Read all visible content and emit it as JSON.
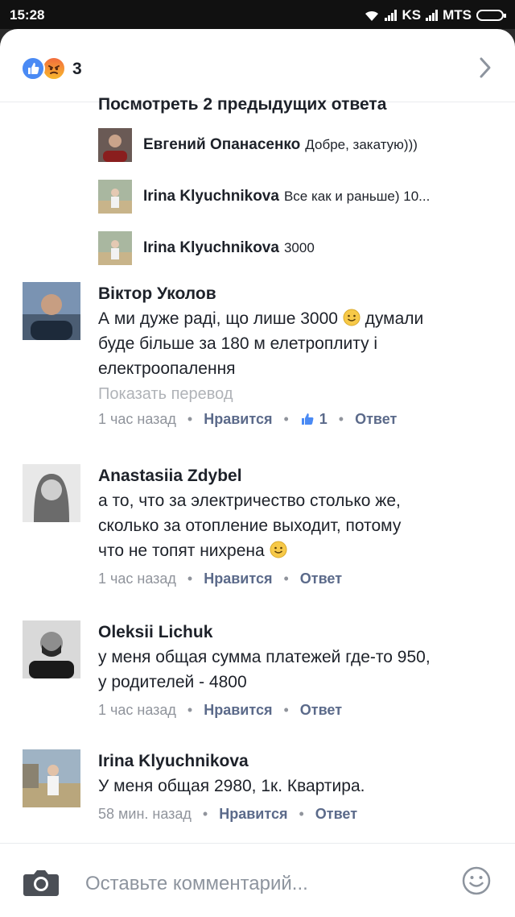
{
  "status": {
    "time": "15:28",
    "carrier1": "KS",
    "carrier2": "MTS"
  },
  "header": {
    "reaction_count": "3"
  },
  "replies": {
    "previous_label": "Посмотреть 2 предыдущих ответа",
    "items": [
      {
        "name": "Евгений Опанасенко",
        "text": "Добре, закатую)))"
      },
      {
        "name": "Irina Klyuchnikova",
        "text": "Все как и раньше) 10..."
      },
      {
        "name": "Irina Klyuchnikova",
        "text": "3000"
      }
    ]
  },
  "comments": [
    {
      "name": "Віктор Уколов",
      "lines": [
        "А ми дуже раді, що лише 3000",
        "думали",
        "буде більше за 180 м елетроплиту і",
        "електроопалення"
      ],
      "translate": "Показать перевод",
      "time": "1 час назад",
      "like": "Нравится",
      "like_count": "1",
      "reply": "Ответ"
    },
    {
      "name": "Anastasiia Zdybel",
      "lines": [
        "а то, что за электричество столько же,",
        "сколько за отопление выходит, потому",
        "что не топят нихрена"
      ],
      "time": "1 час назад",
      "like": "Нравится",
      "reply": "Ответ"
    },
    {
      "name": "Oleksii Lichuk",
      "lines": [
        "у меня общая сумма платежей где-то 950,",
        "у родителей - 4800"
      ],
      "time": "1 час назад",
      "like": "Нравится",
      "reply": "Ответ"
    },
    {
      "name": "Irina Klyuchnikova",
      "lines": [
        "У меня общая 2980, 1к. Квартира."
      ],
      "time": "58 мин. назад",
      "like": "Нравится",
      "reply": "Ответ"
    }
  ],
  "composer": {
    "placeholder": "Оставьте комментарий..."
  },
  "colors": {
    "like_blue": "#4a8af4",
    "link_gray": "#5b6a8a",
    "meta_gray": "#90949c"
  },
  "icons": [
    "wifi-icon",
    "signal-icon",
    "battery-icon",
    "like-reaction-icon",
    "angry-reaction-icon",
    "chevron-right-icon",
    "smiley-emoji-icon",
    "thumbs-up-icon",
    "camera-icon",
    "smiley-icon"
  ]
}
